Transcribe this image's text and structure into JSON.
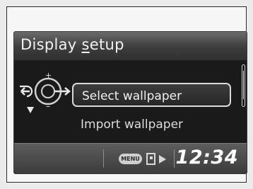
{
  "screen": {
    "title_prefix": "Display ",
    "title_underlined": "s",
    "title_suffix": "etup"
  },
  "menu": {
    "items": [
      {
        "label": "Select wallpaper",
        "selected": true
      },
      {
        "label": "Import wallpaper",
        "selected": false
      }
    ]
  },
  "statusbar": {
    "menu_button_label": "MENU",
    "clock": "12:34"
  },
  "icons": {
    "back": "back-arrow-icon",
    "knob": "interface-dial-icon",
    "down": "down-triangle-icon",
    "exit": "exit-door-arrow-icon"
  },
  "colors": {
    "screen_bg": "#111111",
    "title_bar": "#4a4a4a",
    "text": "#f1f1f1",
    "highlight_border": "#d9d9d9"
  }
}
